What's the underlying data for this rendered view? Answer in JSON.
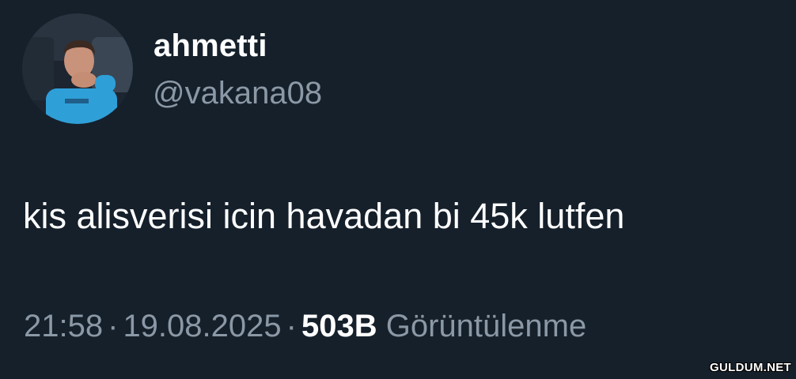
{
  "author": {
    "display_name": "ahmetti",
    "handle": "@vakana08",
    "avatar_icon": "profile-photo-icon"
  },
  "tweet": {
    "text": "kis alisverisi icin havadan bi 45k lutfen"
  },
  "meta": {
    "time": "21:58",
    "separator": "·",
    "date": "19.08.2025",
    "views_count": "503B",
    "views_label": "Görüntülenme"
  },
  "watermark": {
    "text": "GULDUM.NET"
  },
  "colors": {
    "background": "#15202b",
    "primary_text": "#ffffff",
    "secondary_text": "#8b98a5"
  }
}
